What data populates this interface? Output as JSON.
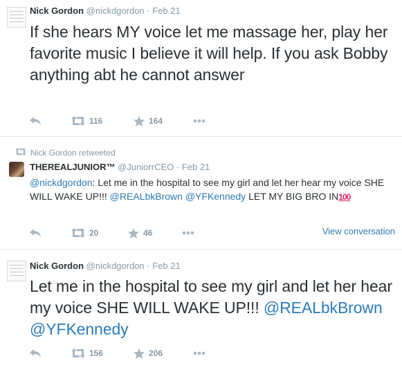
{
  "tweets": [
    {
      "fullname": "Nick Gordon",
      "username": "@nickdgordon",
      "dot": "·",
      "time": "Feb 21",
      "text": "If she hears MY voice let me massage her, play her favorite music I believe it will help. If you ask Bobby anything abt he cannot answer",
      "retweets": "116",
      "favorites": "164"
    },
    {
      "retweeted_by": "Nick Gordon retweeted",
      "fullname": "THEREALJUNIOR™",
      "username": "@JuniorrCEO",
      "dot": "·",
      "time": "Feb 21",
      "mention": "@nickdgordon",
      "text_a": ": Let me in the hospital to see my girl and let her hear my voice SHE WILL WAKE UP!!! ",
      "link1": "@REALbkBrown",
      "link2": "@YFKennedy",
      "text_b": " LET MY BIG BRO IN",
      "emoji": "100",
      "retweets": "20",
      "favorites": "46",
      "view_conversation": "View conversation"
    },
    {
      "fullname": "Nick Gordon",
      "username": "@nickdgordon",
      "dot": "·",
      "time": "Feb 21",
      "text": "Let me in the hospital to see my girl and let her hear my voice SHE WILL WAKE UP!!! ",
      "link1": "@REALbkBrown",
      "link2": "@YFKennedy",
      "retweets": "156",
      "favorites": "206"
    }
  ],
  "icons": {
    "reply": "reply-icon",
    "retweet": "retweet-icon",
    "favorite": "star-icon",
    "more": "more-icon"
  },
  "colors": {
    "link": "#2b7bb9",
    "muted": "#8899a6",
    "icon": "#aab8c2",
    "text": "#292f33"
  }
}
